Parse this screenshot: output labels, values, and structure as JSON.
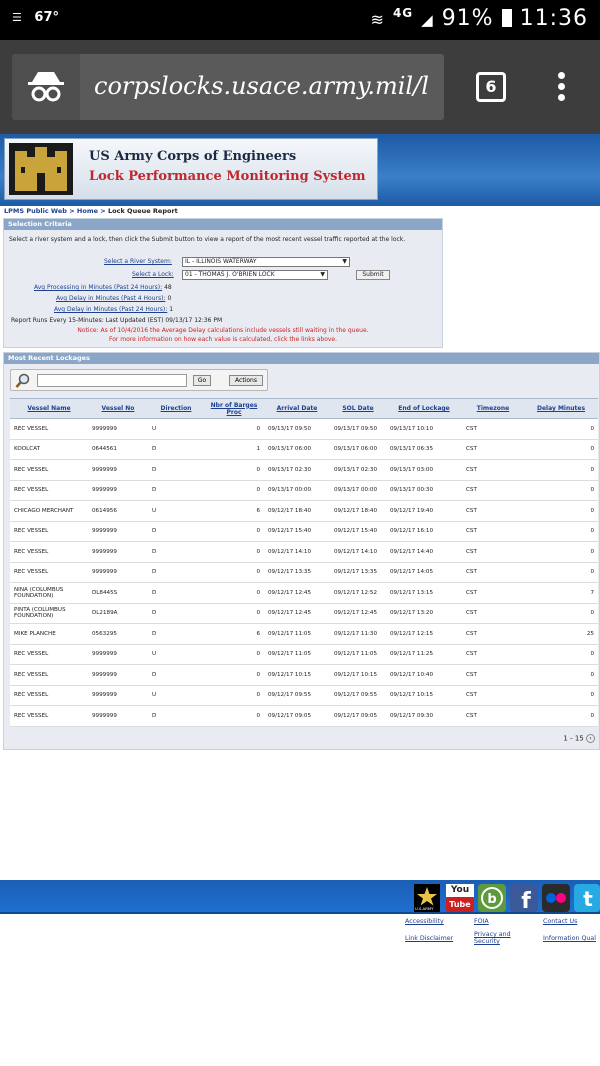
{
  "status_bar": {
    "temperature": "67°",
    "network": "4G",
    "battery": "91%",
    "time": "11:36"
  },
  "browser": {
    "url": "corpslocks.usace.army.mil/l",
    "tab_count": "6"
  },
  "header": {
    "org_name": "US Army Corps of Engineers",
    "system_name": "Lock Performance Monitoring System"
  },
  "breadcrumb": {
    "items": [
      "LPMS Public Web",
      "Home",
      "Lock Queue Report"
    ],
    "separator": ">"
  },
  "selection": {
    "title": "Selection Criteria",
    "instructions": "Select a river system and a lock, then click the Submit button to view a report of the most recent vessel traffic reported at the lock.",
    "river_label": "Select a River System:",
    "river_value": "IL - ILLINOIS WATERWAY",
    "lock_label": "Select a Lock:",
    "lock_value": "01 - THOMAS J. O'BRIEN LOCK",
    "submit_label": "Submit",
    "avg_processing_label": "Avg Processing in Minutes (Past 24 Hours):",
    "avg_processing_value": "48",
    "avg_delay4_label": "Avg Delay in Minutes (Past 4 Hours):",
    "avg_delay4_value": "0",
    "avg_delay24_label": "Avg Delay in Minutes (Past 24 Hours):",
    "avg_delay24_value": "1",
    "report_runs": "Report Runs Every 15-Minutes: Last Updated (EST) 09/13/17 12:36 PM",
    "notice1": "Notice: As of 10/4/2016 the Average Delay calculations include vessels still waiting in the queue.",
    "notice2": "For more information on how each value is calculated, click the links above."
  },
  "lockages": {
    "title": "Most Recent Lockages",
    "go_label": "Go",
    "actions_label": "Actions",
    "columns": [
      "Vessel Name",
      "Vessel No",
      "Direction",
      "Nbr of Barges Proc",
      "Arrival Date",
      "SOL Date",
      "End of Lockage",
      "Timezone",
      "Delay Minutes"
    ],
    "rows": [
      [
        "REC VESSEL",
        "9999999",
        "U",
        "0",
        "09/13/17 09:50",
        "09/13/17 09:50",
        "09/13/17 10:10",
        "CST",
        "0"
      ],
      [
        "KOOLCAT",
        "0644561",
        "D",
        "1",
        "09/13/17 06:00",
        "09/13/17 06:00",
        "09/13/17 06:35",
        "CST",
        "0"
      ],
      [
        "REC VESSEL",
        "9999999",
        "D",
        "0",
        "09/13/17 02:30",
        "09/13/17 02:30",
        "09/13/17 03:00",
        "CST",
        "0"
      ],
      [
        "REC VESSEL",
        "9999999",
        "D",
        "0",
        "09/13/17 00:00",
        "09/13/17 00:00",
        "09/13/17 00:30",
        "CST",
        "0"
      ],
      [
        "CHICAGO MERCHANT",
        "0614956",
        "U",
        "6",
        "09/12/17 18:40",
        "09/12/17 18:40",
        "09/12/17 19:40",
        "CST",
        "0"
      ],
      [
        "REC VESSEL",
        "9999999",
        "D",
        "0",
        "09/12/17 15:40",
        "09/12/17 15:40",
        "09/12/17 16:10",
        "CST",
        "0"
      ],
      [
        "REC VESSEL",
        "9999999",
        "D",
        "0",
        "09/12/17 14:10",
        "09/12/17 14:10",
        "09/12/17 14:40",
        "CST",
        "0"
      ],
      [
        "REC VESSEL",
        "9999999",
        "D",
        "0",
        "09/12/17 13:35",
        "09/12/17 13:35",
        "09/12/17 14:05",
        "CST",
        "0"
      ],
      [
        "NINA (COLUMBUS FOUNDATION)",
        "DL8445S",
        "D",
        "0",
        "09/12/17 12:45",
        "09/12/17 12:52",
        "09/12/17 13:15",
        "CST",
        "7"
      ],
      [
        "PINTA (COLUMBUS FOUNDATION)",
        "DL2189A",
        "D",
        "0",
        "09/12/17 12:45",
        "09/12/17 12:45",
        "09/12/17 13:20",
        "CST",
        "0"
      ],
      [
        "MIKE PLANCHE",
        "0563295",
        "D",
        "6",
        "09/12/17 11:05",
        "09/12/17 11:30",
        "09/12/17 12:15",
        "CST",
        "25"
      ],
      [
        "REC VESSEL",
        "9999999",
        "U",
        "0",
        "09/12/17 11:05",
        "09/12/17 11:05",
        "09/12/17 11:25",
        "CST",
        "0"
      ],
      [
        "REC VESSEL",
        "9999999",
        "D",
        "0",
        "09/12/17 10:15",
        "09/12/17 10:15",
        "09/12/17 10:40",
        "CST",
        "0"
      ],
      [
        "REC VESSEL",
        "9999999",
        "U",
        "0",
        "09/12/17 09:55",
        "09/12/17 09:55",
        "09/12/17 10:15",
        "CST",
        "0"
      ],
      [
        "REC VESSEL",
        "9999999",
        "D",
        "0",
        "09/12/17 09:05",
        "09/12/17 09:05",
        "09/12/17 09:30",
        "CST",
        "0"
      ]
    ],
    "pagination": "1 - 15"
  },
  "footer": {
    "youtube_top": "You",
    "youtube_bottom": "Tube",
    "army_label": "U.S.ARMY",
    "links": [
      {
        "label": "Accessibility"
      },
      {
        "label": "FOIA"
      },
      {
        "label": "Contact Us"
      },
      {
        "label": "Link Disclaimer"
      },
      {
        "label": "Privacy and Security"
      },
      {
        "label": "Information Qual"
      }
    ]
  }
}
